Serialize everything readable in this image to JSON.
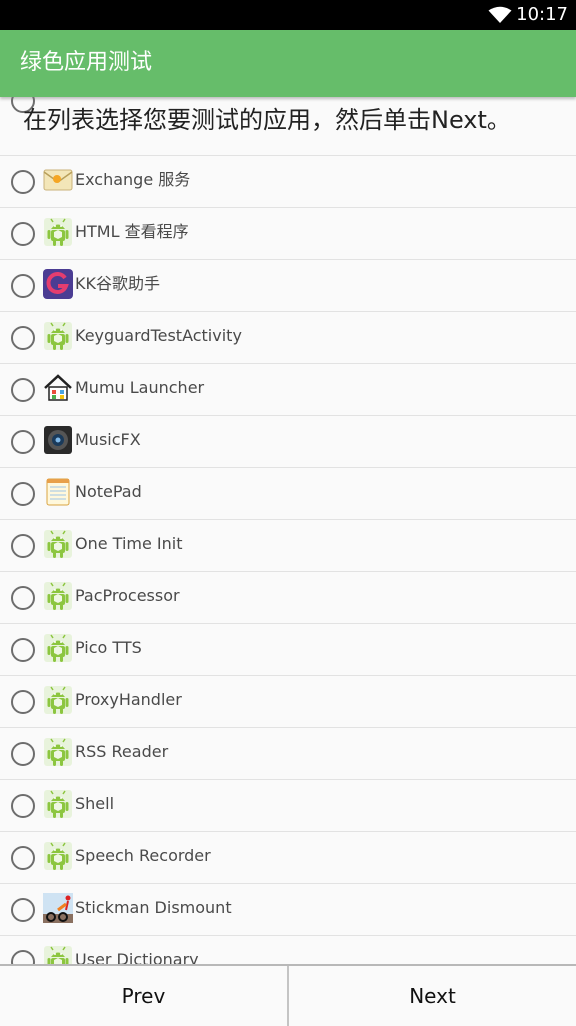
{
  "status_bar": {
    "time": "10:17",
    "wifi_icon": "wifi-icon"
  },
  "app_bar": {
    "title": "绿色应用测试"
  },
  "instruction": "在列表选择您要测试的应用，然后单击Next。",
  "apps": [
    {
      "label": "Exchange 服务",
      "icon": "exchange-icon"
    },
    {
      "label": "HTML 查看程序",
      "icon": "android-icon"
    },
    {
      "label": "KK谷歌助手",
      "icon": "kk-google-icon"
    },
    {
      "label": "KeyguardTestActivity",
      "icon": "android-icon"
    },
    {
      "label": "Mumu Launcher",
      "icon": "house-icon"
    },
    {
      "label": "MusicFX",
      "icon": "speaker-icon"
    },
    {
      "label": "NotePad",
      "icon": "notepad-icon"
    },
    {
      "label": "One Time Init",
      "icon": "android-icon"
    },
    {
      "label": "PacProcessor",
      "icon": "android-icon"
    },
    {
      "label": "Pico TTS",
      "icon": "android-icon"
    },
    {
      "label": "ProxyHandler",
      "icon": "android-icon"
    },
    {
      "label": "RSS Reader",
      "icon": "android-icon"
    },
    {
      "label": "Shell",
      "icon": "android-icon"
    },
    {
      "label": "Speech Recorder",
      "icon": "android-icon"
    },
    {
      "label": "Stickman Dismount",
      "icon": "stickman-icon"
    },
    {
      "label": "User Dictionary",
      "icon": "android-icon"
    }
  ],
  "buttons": {
    "prev": "Prev",
    "next": "Next"
  },
  "colors": {
    "app_bar": "#66bd6a",
    "status_bar": "#000000",
    "android_green": "#8cc63f"
  }
}
